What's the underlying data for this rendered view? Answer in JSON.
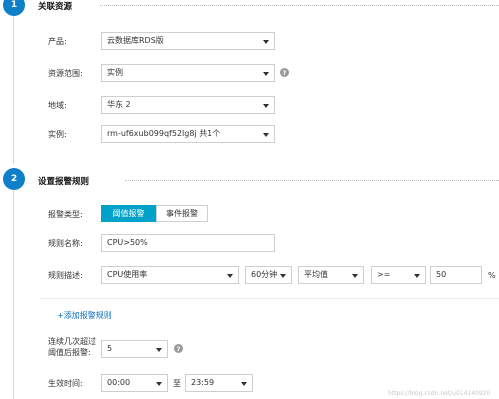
{
  "section1": {
    "number": "1",
    "title": "关联资源"
  },
  "section2": {
    "number": "2",
    "title": "设置报警规则"
  },
  "resource": {
    "product": {
      "label": "产品:",
      "value": "云数据库RDS版"
    },
    "scope": {
      "label": "资源范围:",
      "value": "实例"
    },
    "region": {
      "label": "地域:",
      "value": "华东 2"
    },
    "instance": {
      "label": "实例:",
      "value": "rm-uf6xub099qf52lg8j 共1个"
    }
  },
  "rule": {
    "type_label": "报警类型:",
    "type_options": [
      "阈值报警",
      "事件报警"
    ],
    "name_label": "规则名称:",
    "name_value": "CPU>50%",
    "desc_label": "规则描述:",
    "metric": "CPU使用率",
    "period": "60分钟",
    "stat": "平均值",
    "operator": ">=",
    "threshold": "50",
    "unit": "%",
    "add_rule_link": "+添加报警规则"
  },
  "trigger": {
    "label_line1": "连续几次超过",
    "label_line2": "阈值后报警:",
    "value": "5"
  },
  "effective": {
    "label": "生效时间:",
    "start": "00:00",
    "separator": "至",
    "end": "23:59"
  },
  "watermark": "https://blog.csdn.net/u014140920"
}
